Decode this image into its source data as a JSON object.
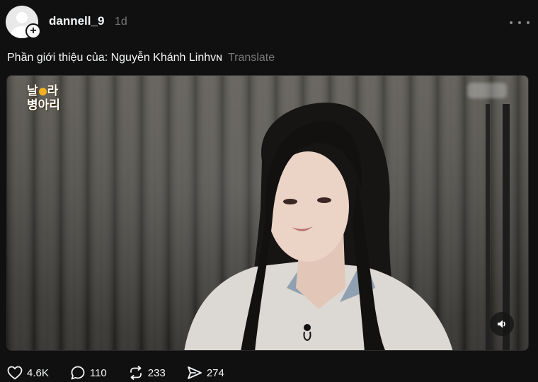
{
  "post": {
    "username": "dannell_9",
    "timestamp": "1d",
    "caption": "Phần giới thiệu của: Nguyễn Khánh Linhᴠɴ",
    "translate_label": "Translate",
    "follow_symbol": "+"
  },
  "video": {
    "channel_logo_line1_a": "날",
    "channel_logo_line1_b": "라",
    "channel_logo_line2": "병아리",
    "mute_icon": "speaker-icon"
  },
  "actions": {
    "likes": "4.6K",
    "comments": "110",
    "reposts": "233",
    "shares": "274"
  },
  "colors": {
    "background": "#101010",
    "text_primary": "#f3f5f7",
    "text_secondary": "#777777"
  }
}
